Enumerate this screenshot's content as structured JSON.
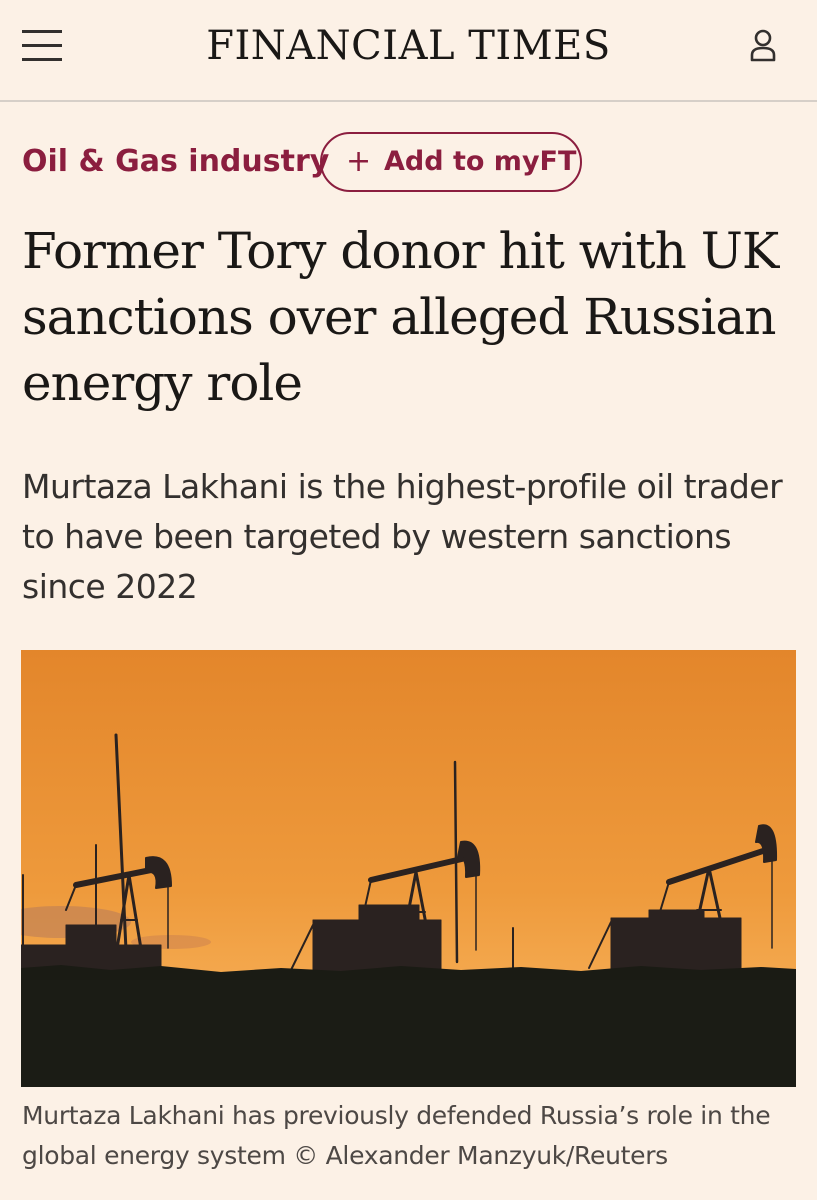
{
  "header": {
    "masthead": "FINANCIAL TIMES",
    "menu_icon": "hamburger-menu-icon",
    "account_icon": "user-icon"
  },
  "topic": {
    "label": "Oil & Gas industry",
    "follow_button": {
      "icon": "plus-icon",
      "label": "Add to myFT"
    }
  },
  "article": {
    "headline": "Former Tory donor hit with UK sanctions over alleged Russian energy role",
    "standfirst": "Murtaza Lakhani is the highest-profile oil trader to have been targeted by western sanctions since 2022",
    "image_caption": "Murtaza Lakhani has previously defended Russia’s role in the global energy system © Alexander Manzyuk/Reuters"
  },
  "colors": {
    "background": "#fcf1e6",
    "accent": "#8b1e3f",
    "text": "#1a1816",
    "sky_top": "#e58a2c",
    "sky_horizon": "#f6ad55"
  }
}
